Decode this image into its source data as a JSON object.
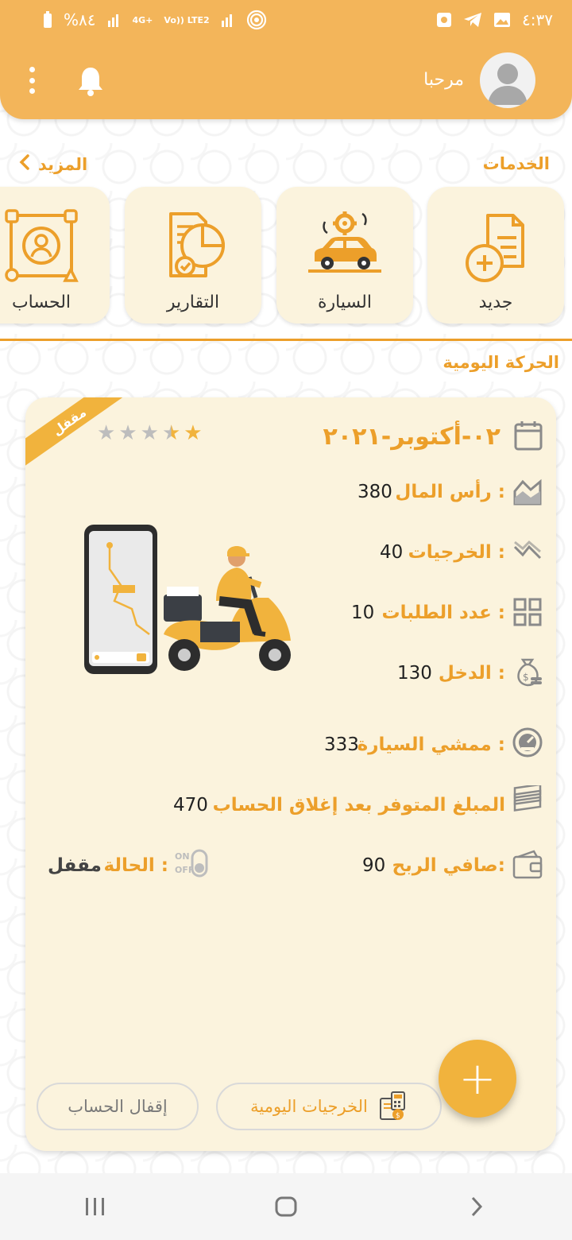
{
  "status_bar": {
    "time": "٤:٣٧",
    "battery": "%٨٤",
    "network": "4G+",
    "volte": "Vo)) LTE2"
  },
  "header": {
    "welcome": "مرحبا"
  },
  "services": {
    "title": "الخدمات",
    "more": "المزيد",
    "items": [
      {
        "label": "جديد",
        "icon": "new-document-icon"
      },
      {
        "label": "السيارة",
        "icon": "car-service-icon"
      },
      {
        "label": "التقارير",
        "icon": "reports-icon"
      },
      {
        "label": "الحساب",
        "icon": "account-icon"
      }
    ]
  },
  "daily": {
    "title": "الحركة اليومية",
    "status_ribbon": "مقفل",
    "date": "٠٢-أكتوبر-٢٠٢١",
    "rating": 1.5,
    "rating_max": 5,
    "capital_label": "رأس المال :",
    "capital_value": "380",
    "expenses_label": "الخرجيات :",
    "expenses_value": "40",
    "orders_label": "عدد الطلبات :",
    "orders_value": "10",
    "income_label": "الدخل :",
    "income_value": "130",
    "mileage_label": "ممشي السيارة :",
    "mileage_value": "333",
    "available_label": "المبلغ المتوفر بعد إغلاق الحساب",
    "available_value": "470",
    "net_profit_label": "صافي الربح:",
    "net_profit_value": "90",
    "state_label": "الحالة :",
    "state_value": "مقفل",
    "daily_expenses_button": "الخرجيات اليومية",
    "close_account_button": "إقفال الحساب",
    "fab": "+"
  },
  "colors": {
    "primary": "#f3b55a",
    "accent": "#ec9f2a",
    "card": "#fbf3dd"
  }
}
